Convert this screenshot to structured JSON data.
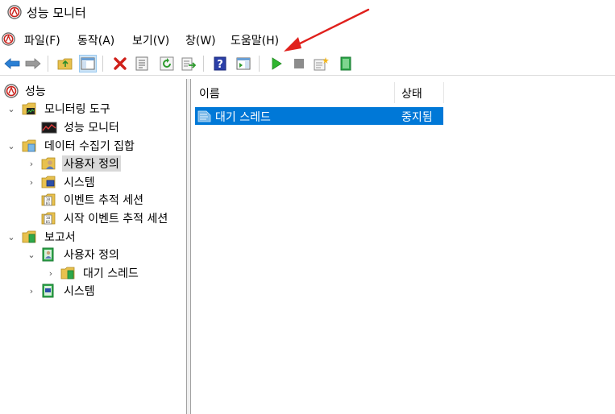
{
  "window": {
    "title": "성능 모니터"
  },
  "menu": [
    "파일(F)",
    "동작(A)",
    "보기(V)",
    "창(W)",
    "도움말(H)"
  ],
  "toolbar": {
    "buttons": [
      {
        "name": "back-arrow-icon"
      },
      {
        "name": "forward-arrow-icon"
      },
      {
        "name": "up-folder-icon"
      },
      {
        "name": "show-hide-console-tree-icon"
      },
      {
        "name": "delete-icon"
      },
      {
        "name": "properties-icon"
      },
      {
        "name": "refresh-icon"
      },
      {
        "name": "export-list-icon"
      },
      {
        "name": "help-icon"
      },
      {
        "name": "show-hide-action-pane-icon"
      },
      {
        "name": "start-icon"
      },
      {
        "name": "stop-icon"
      },
      {
        "name": "new-icon"
      },
      {
        "name": "book-icon"
      }
    ]
  },
  "tree": {
    "root": "성능",
    "monitoring_tools": "모니터링 도구",
    "performance_monitor": "성능 모니터",
    "data_collector_sets": "데이터 수집기 집합",
    "user_defined": "사용자 정의",
    "system": "시스템",
    "event_trace_sessions": "이벤트 추적 세션",
    "startup_event_trace_sessions": "시작 이벤트 추적 세션",
    "reports": "보고서",
    "reports_user_defined": "사용자 정의",
    "reports_idle_thread": "대기 스레드",
    "reports_system": "시스템"
  },
  "list": {
    "columns": [
      "이름",
      "상태"
    ],
    "rows": [
      {
        "name": "대기 스레드",
        "status": "중지됨"
      }
    ]
  },
  "colors": {
    "selection": "#0078d7",
    "annotation_arrow": "#e0201c"
  }
}
